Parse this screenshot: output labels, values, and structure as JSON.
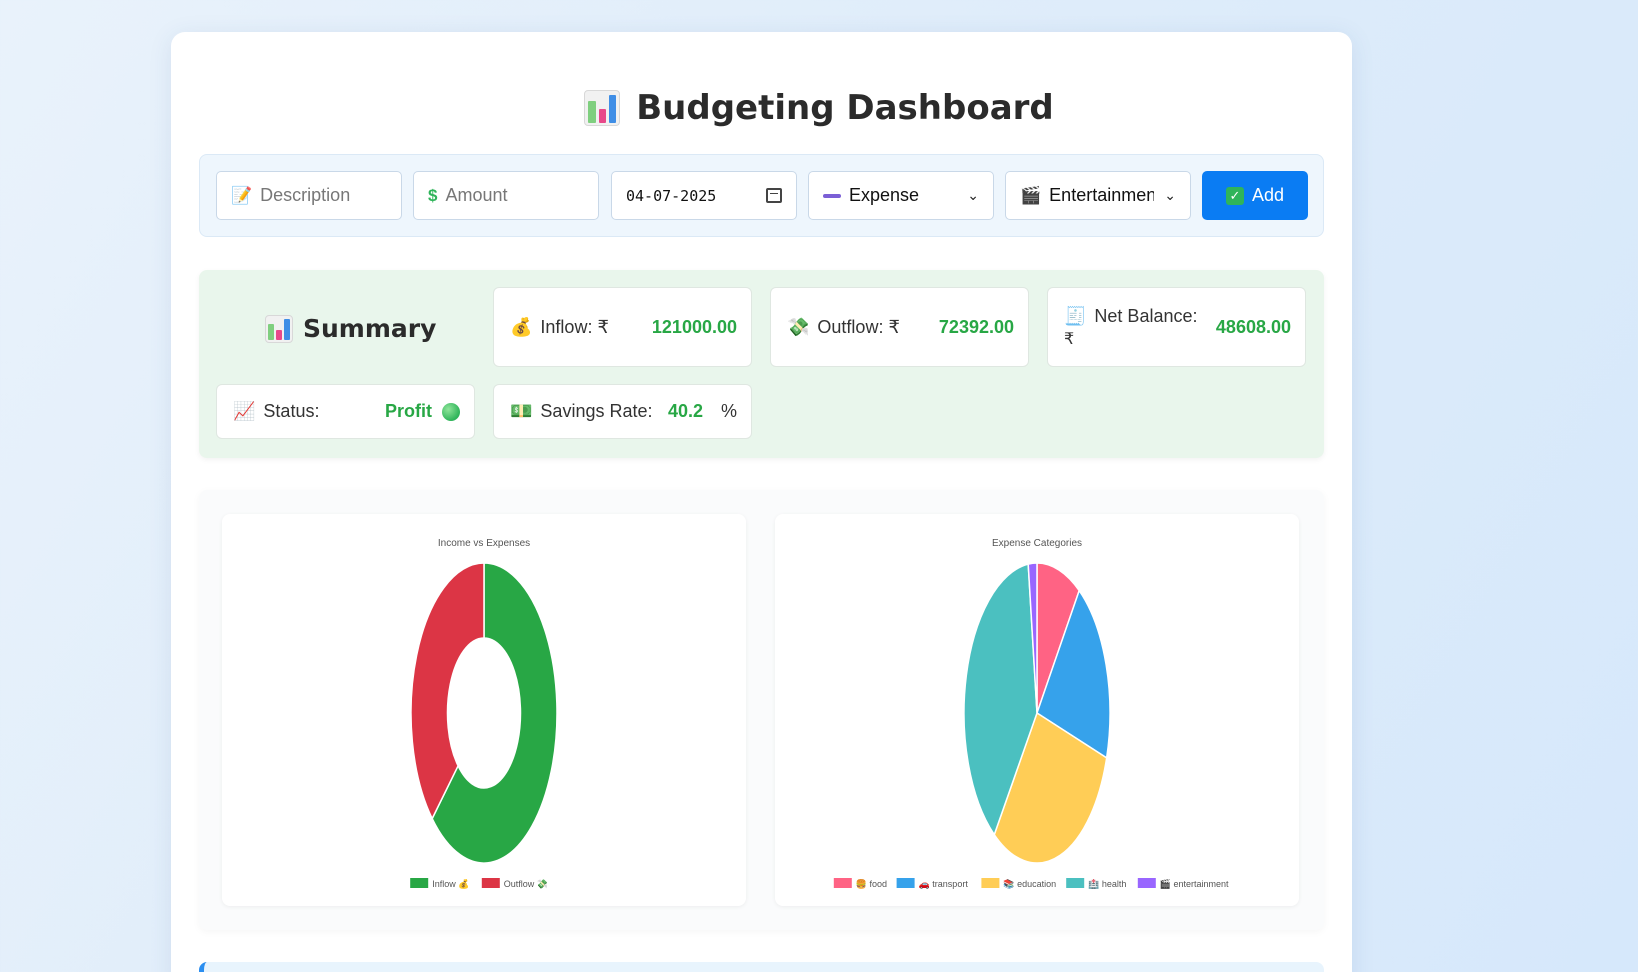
{
  "page": {
    "title": "Budgeting Dashboard",
    "title_icon": "bar-chart-emoji"
  },
  "form": {
    "description_placeholder": "Description",
    "amount_placeholder": "Amount",
    "date_value": "04-07-2025",
    "type_value": "Expense",
    "category_value": "Entertainment",
    "add_label": "Add",
    "description_icon": "memo-icon",
    "amount_icon": "dollar-icon",
    "type_icon": "minus-icon",
    "category_icon": "clapper-icon"
  },
  "summary": {
    "heading": "Summary",
    "inflow": {
      "label": "Inflow: ₹",
      "value": "121000.00",
      "icon": "money-bag-icon"
    },
    "outflow": {
      "label": "Outflow: ₹",
      "value": "72392.00",
      "icon": "money-wings-icon"
    },
    "net": {
      "label": "Net Balance:",
      "currency": "₹",
      "value": "48608.00",
      "icon": "receipt-icon"
    },
    "status": {
      "label": "Status:",
      "value": "Profit",
      "icon": "chart-up-icon"
    },
    "savings": {
      "label": "Savings Rate:",
      "value": "40.2",
      "unit": "%",
      "icon": "cash-icon"
    }
  },
  "colors": {
    "accent": "#0a7cf3",
    "positive": "#28a745",
    "negative": "#dc3545"
  },
  "chart_data": [
    {
      "type": "pie",
      "title": "Income vs Expenses",
      "donut": true,
      "categories": [
        "Inflow 💰",
        "Outflow 💸"
      ],
      "values": [
        121000,
        72392
      ],
      "colors": [
        "#28a745",
        "#dc3545"
      ],
      "legend": "bottom"
    },
    {
      "type": "pie",
      "title": "Expense Categories",
      "donut": false,
      "categories": [
        "🍔 food",
        "🚗 transport",
        "📚 education",
        "🏥 health",
        "🎬 entertainment"
      ],
      "values": [
        7100,
        14500,
        21800,
        27600,
        1392
      ],
      "colors": [
        "#ff6384",
        "#36a2eb",
        "#ffcd56",
        "#4bc0c0",
        "#9966ff"
      ],
      "legend": "bottom"
    }
  ]
}
